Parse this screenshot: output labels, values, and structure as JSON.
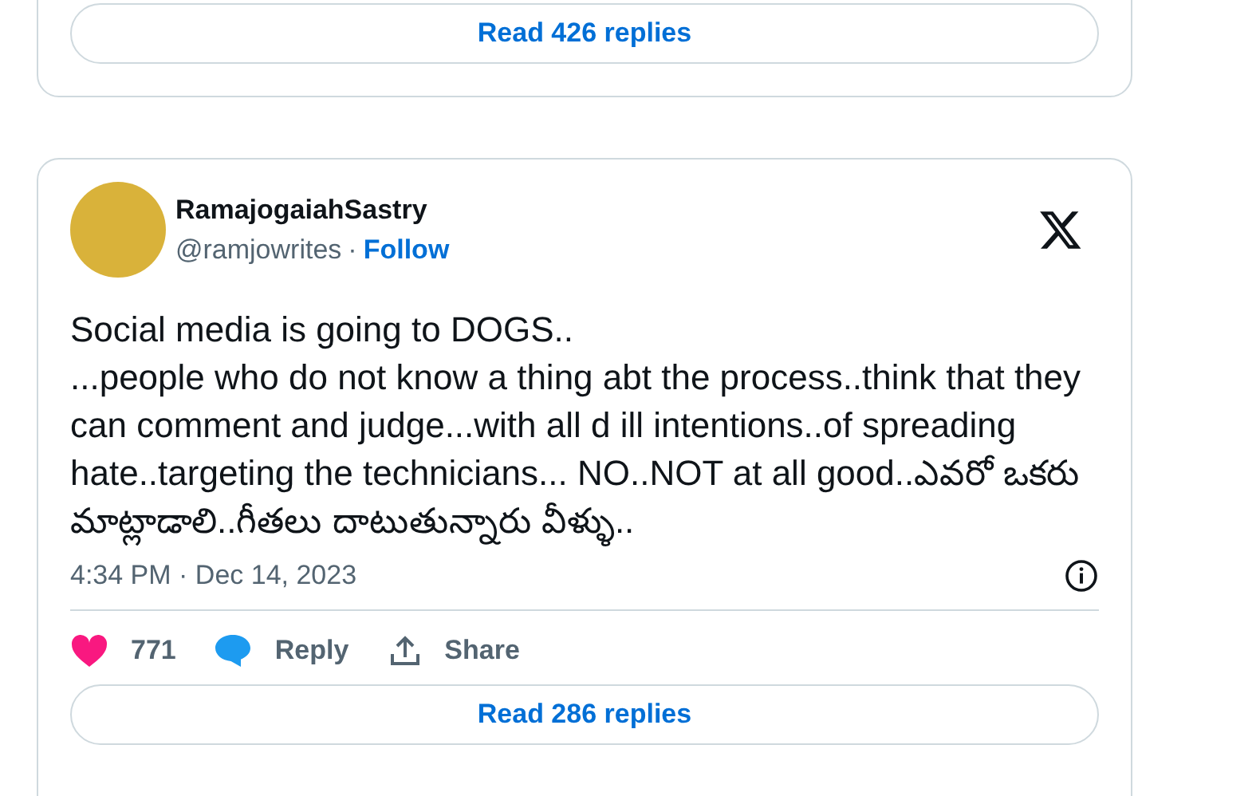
{
  "previous_card": {
    "read_replies": "Read 426 replies"
  },
  "tweet": {
    "author": {
      "name": "RamajogaiahSastry",
      "handle": "@ramjowrites",
      "separator": "·",
      "follow": "Follow"
    },
    "text": "Social media is going to DOGS..\n...people who do not know a thing abt the process..think that they can comment and judge...with all d ill intentions..of spreading hate..targeting the technicians... NO..NOT at all good..ఎవరో ఒకరు మాట్లాడాలి..గీతలు దాటుతున్నారు వీళ్ళు..",
    "timestamp": "4:34 PM · Dec 14, 2023",
    "actions": [
      {
        "kind": "like",
        "label": "771"
      },
      {
        "kind": "reply",
        "label": "Reply"
      },
      {
        "kind": "share",
        "label": "Share"
      }
    ],
    "read_replies": "Read 286 replies"
  }
}
